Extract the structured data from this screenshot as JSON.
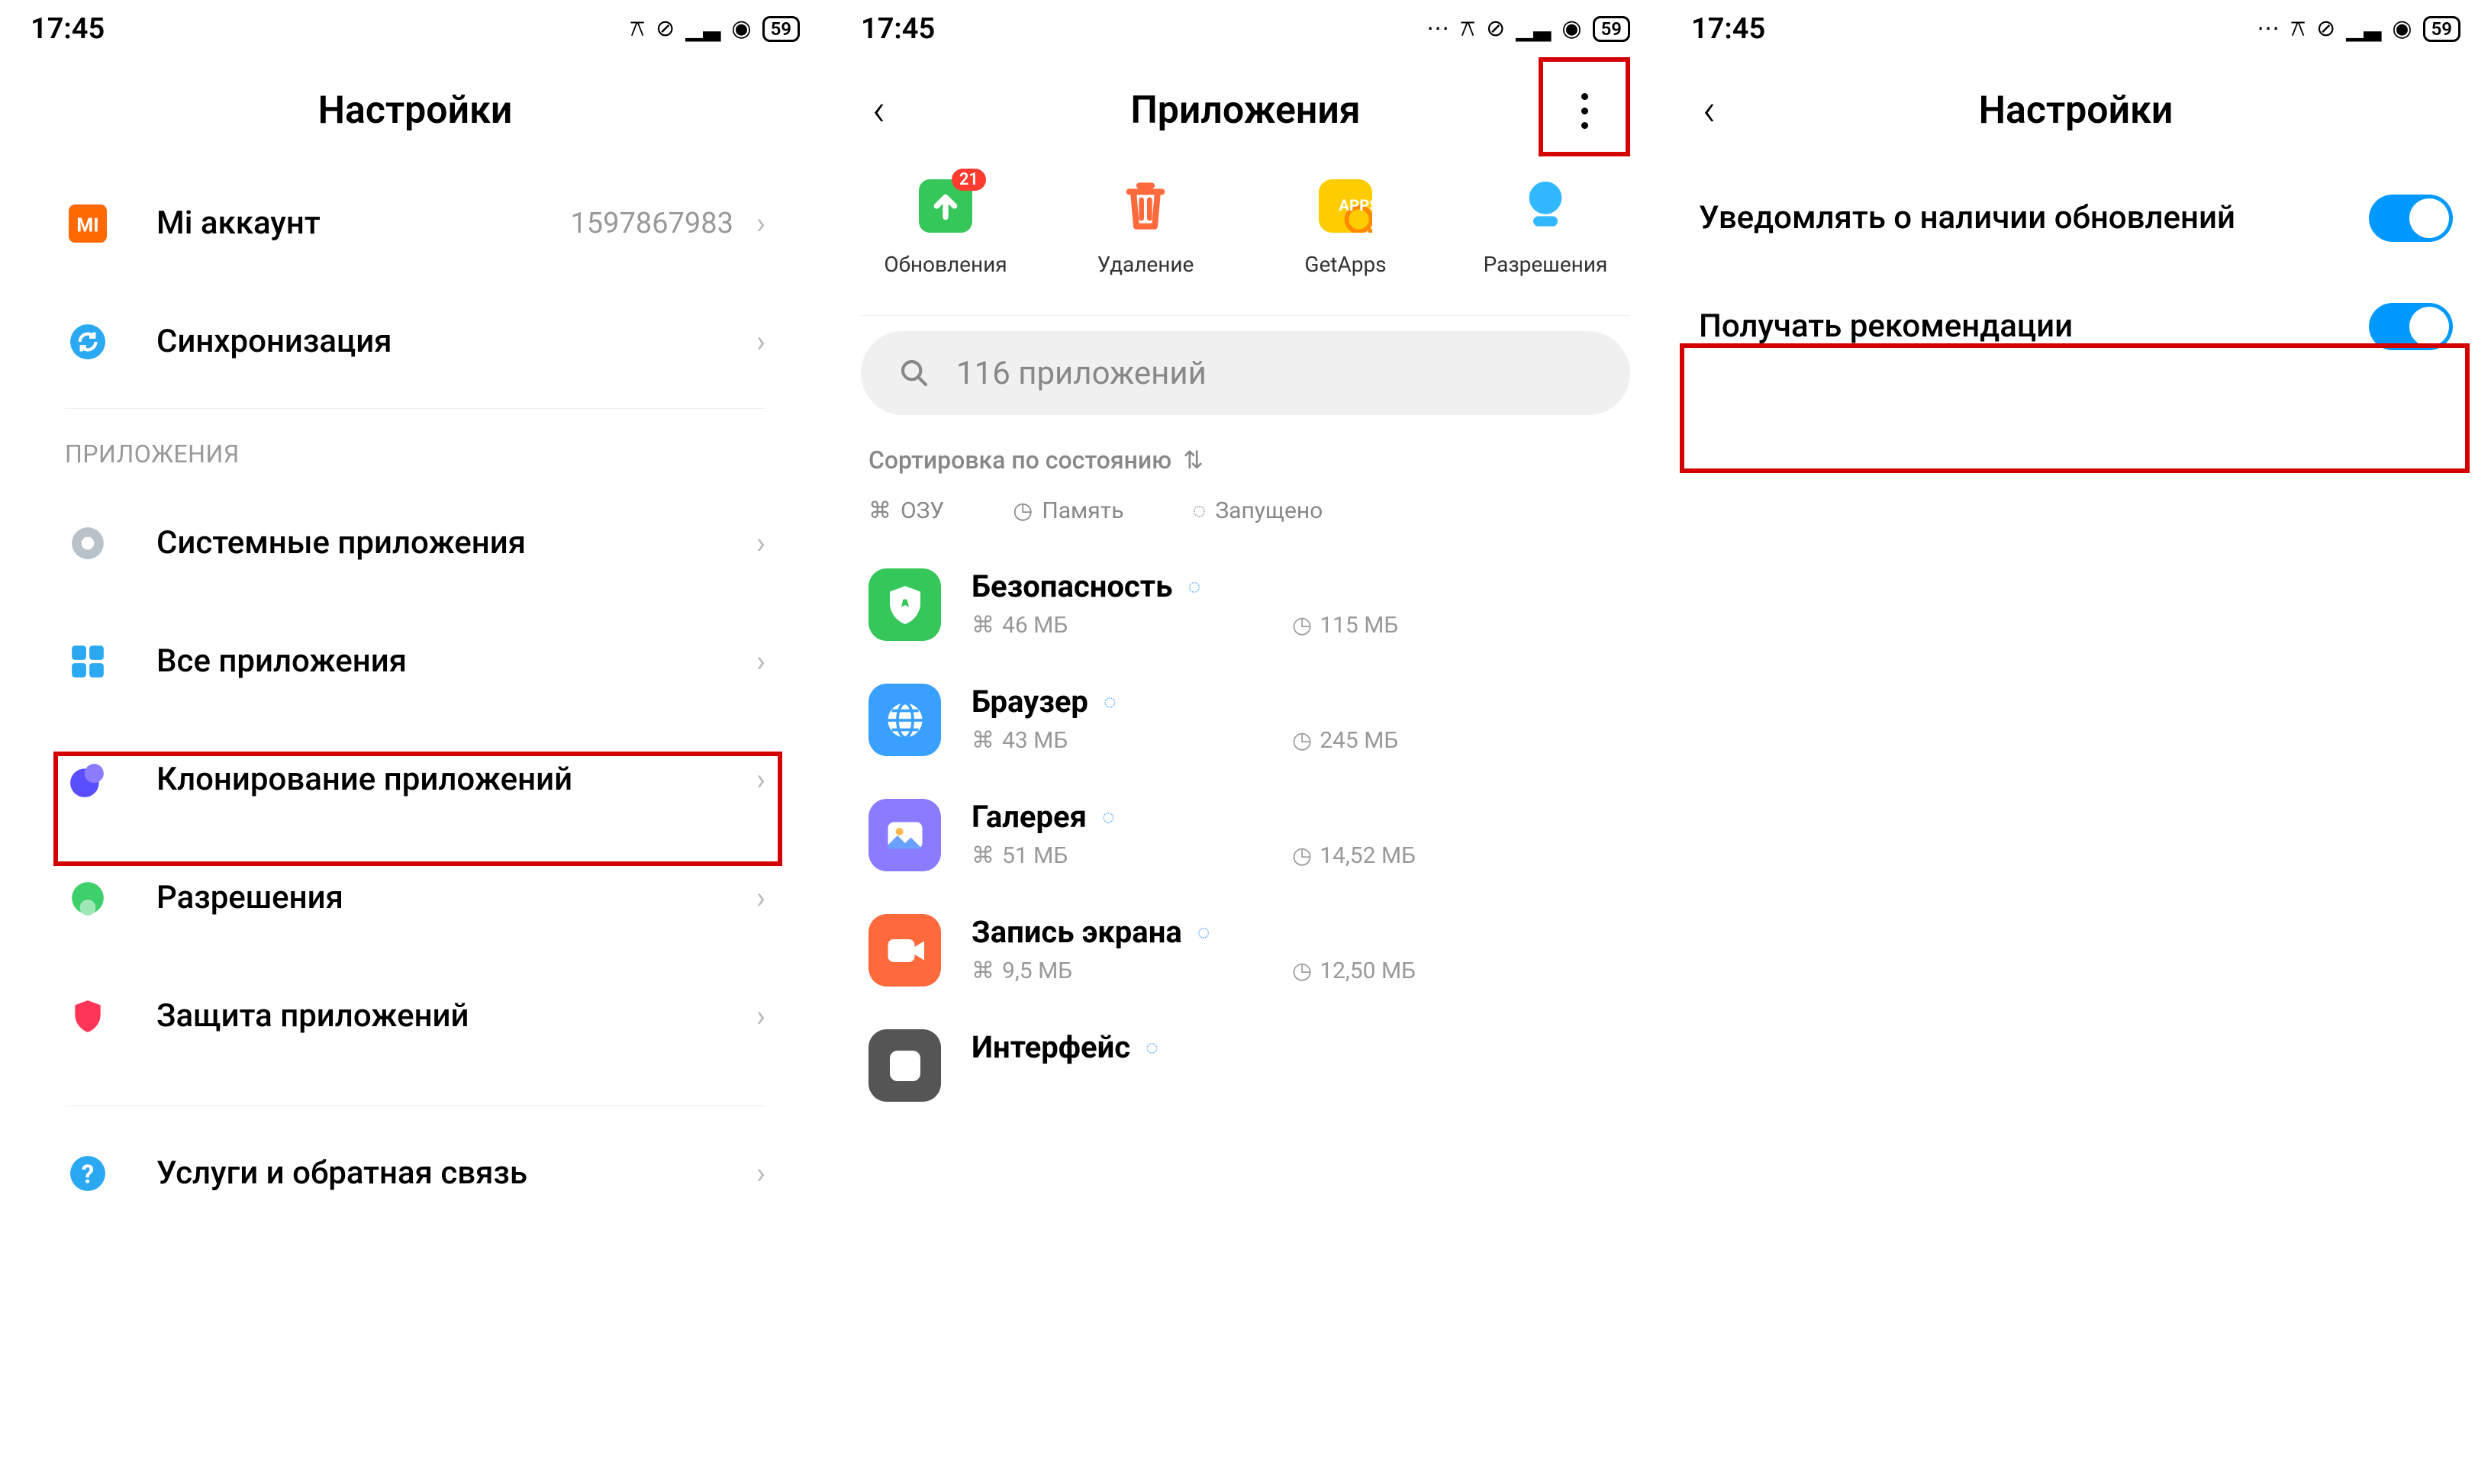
{
  "status": {
    "time": "17:45",
    "battery": "59"
  },
  "screen1": {
    "title": "Настройки",
    "rows": {
      "miaccount": {
        "label": "Mi аккаунт",
        "value": "1597867983"
      },
      "sync": {
        "label": "Синхронизация"
      }
    },
    "section_apps": "ПРИЛОЖЕНИЯ",
    "apps_rows": {
      "system_apps": "Системные приложения",
      "all_apps": "Все приложения",
      "clone_apps": "Клонирование приложений",
      "permissions": "Разрешения",
      "app_protection": "Защита приложений"
    },
    "support": "Услуги и обратная связь"
  },
  "screen2": {
    "title": "Приложения",
    "shortcuts": {
      "updates": {
        "label": "Обновления",
        "badge": "21"
      },
      "uninstall": {
        "label": "Удаление"
      },
      "getapps": {
        "label": "GetApps"
      },
      "permissions": {
        "label": "Разрешения"
      }
    },
    "search_placeholder": "116 приложений",
    "sort_label": "Сортировка по состоянию",
    "columns": {
      "ram": "ОЗУ",
      "storage": "Память",
      "running": "Запущено"
    },
    "apps": [
      {
        "name": "Безопасность",
        "ram": "46 МБ",
        "storage": "115 МБ",
        "icon_bg": "#35c759",
        "glyph": "shield"
      },
      {
        "name": "Браузер",
        "ram": "43 МБ",
        "storage": "245 МБ",
        "icon_bg": "#3aa0ff",
        "glyph": "globe"
      },
      {
        "name": "Галерея",
        "ram": "51 МБ",
        "storage": "14,52 МБ",
        "icon_bg": "#8a7bff",
        "glyph": "gallery"
      },
      {
        "name": "Запись экрана",
        "ram": "9,5 МБ",
        "storage": "12,50 МБ",
        "icon_bg": "#ff6a3d",
        "glyph": "record"
      },
      {
        "name": "Интерфейс",
        "ram": "",
        "storage": "",
        "icon_bg": "#555",
        "glyph": "system"
      }
    ]
  },
  "screen3": {
    "title": "Настройки",
    "toggles": {
      "notify_updates": {
        "label": "Уведомлять о наличии обновлений",
        "on": true
      },
      "recommendations": {
        "label": "Получать рекомендации",
        "on": true
      }
    }
  }
}
